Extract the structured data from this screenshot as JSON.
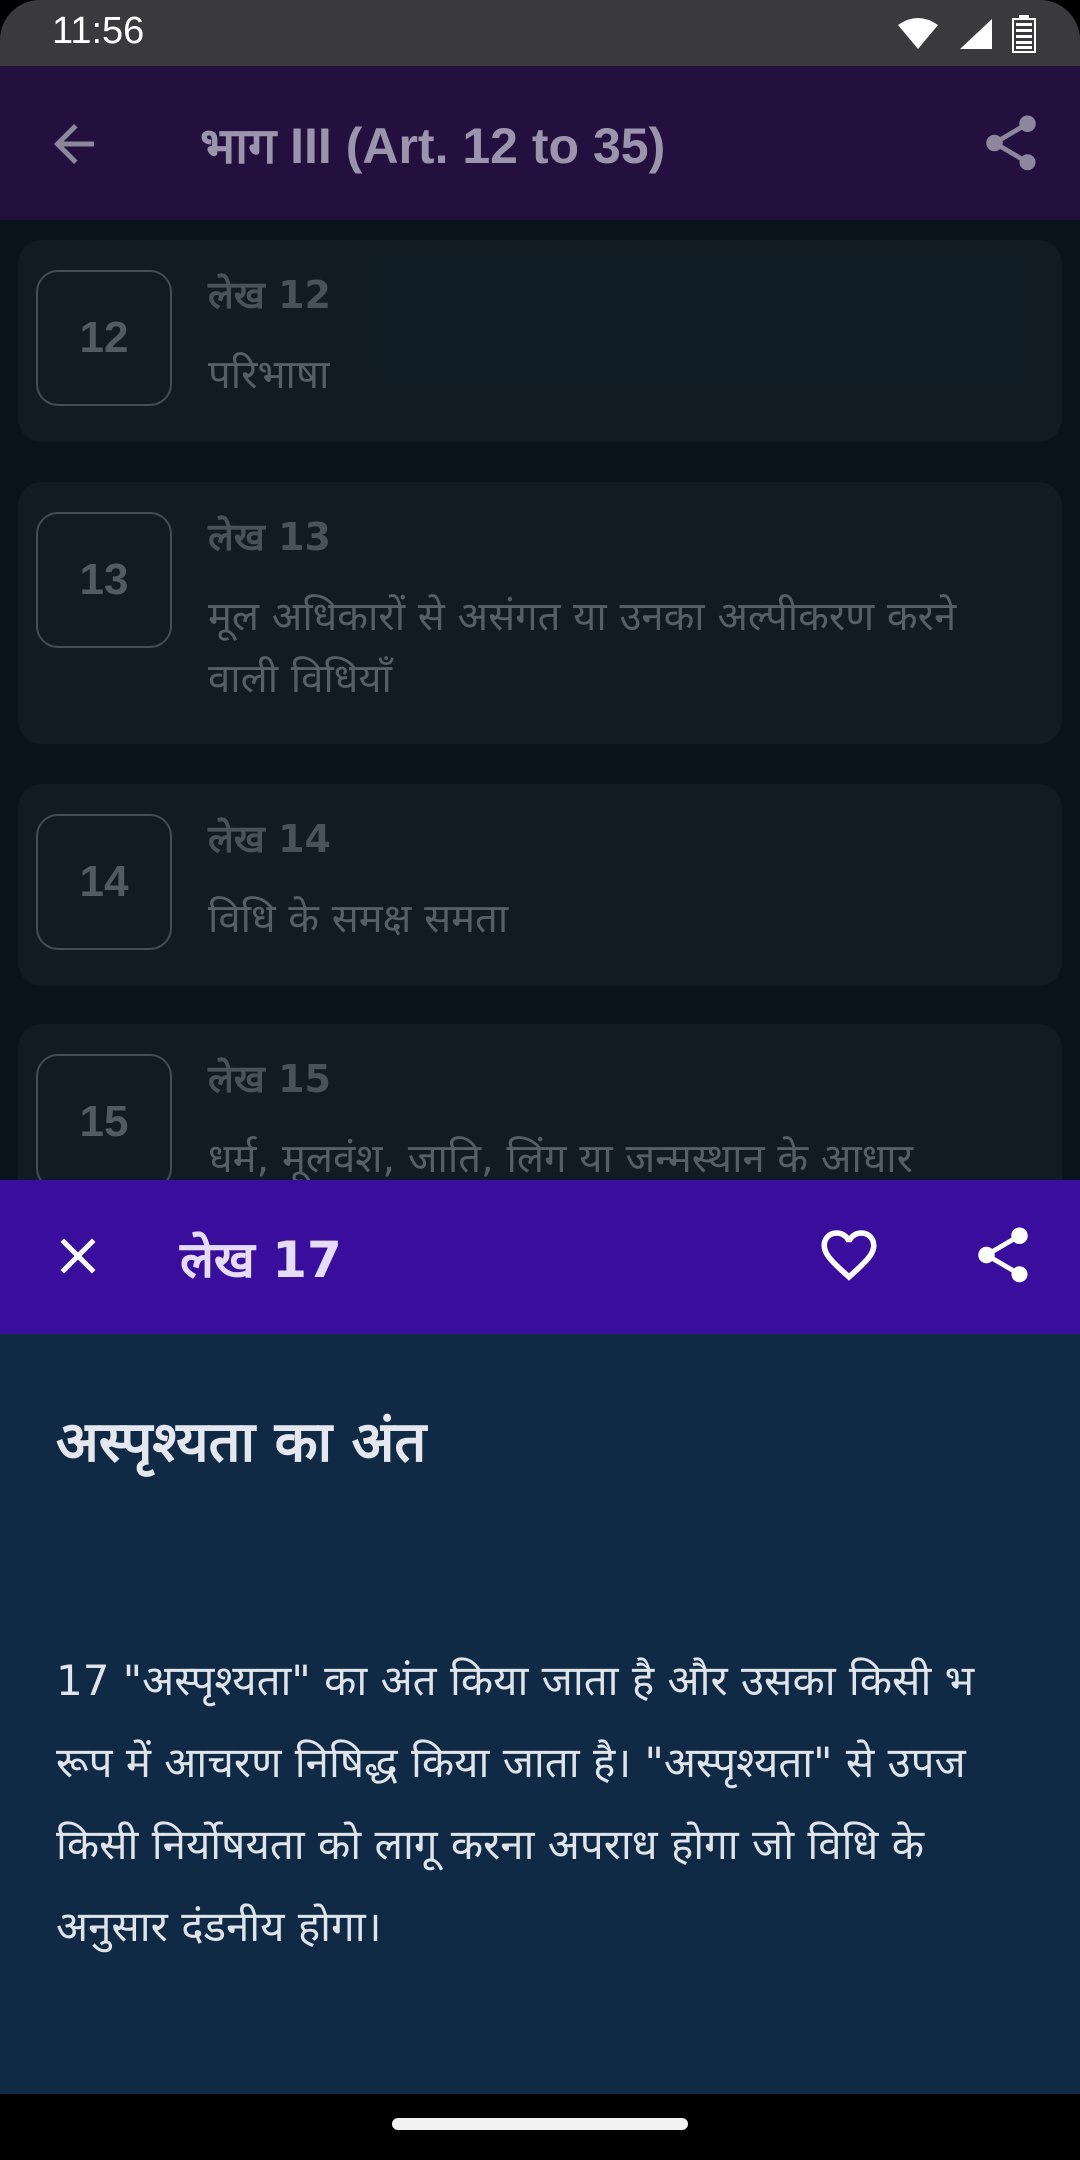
{
  "status_bar": {
    "time": "11:56",
    "icons": [
      "wifi-icon",
      "signal-icon",
      "battery-icon"
    ]
  },
  "app_bar": {
    "title": "भाग III (Art. 12 to 35)",
    "back_icon": "arrow-back-icon",
    "share_icon": "share-icon"
  },
  "articles": [
    {
      "number": "12",
      "label": "लेख 12",
      "desc": " परिभाषा"
    },
    {
      "number": "13",
      "label": "लेख 13",
      "desc": " मूल अधिकारों से असंगत या उनका अल्पीकरण करने वाली विधियाँ"
    },
    {
      "number": "14",
      "label": "लेख 14",
      "desc": " विधि के समक्ष समता"
    },
    {
      "number": "15",
      "label": "लेख 15",
      "desc": " धर्म, मूलवंश, जाति, लिंग या जन्मस्थान के आधार"
    }
  ],
  "sheet": {
    "title": "लेख 17",
    "heading": "अस्पृश्यता का अंत",
    "body": "17 \"अस्पृश्यता\" का अंत किया जाता है और उसका किसी भ रूप में आचरण निषिद्ध किया जाता है। \"अस्पृश्यता\" से उपज किसी निर्योषयता को लागू करना अपराध होगा जो विधि के अनुसार दंडनीय होगा।",
    "close_icon": "close-icon",
    "favorite_icon": "heart-icon",
    "share_icon": "share-icon"
  },
  "colors": {
    "app_bar": "#23103f",
    "sheet_header": "#3a0e9c",
    "sheet_body": "#102a45",
    "card": "#121f29"
  }
}
